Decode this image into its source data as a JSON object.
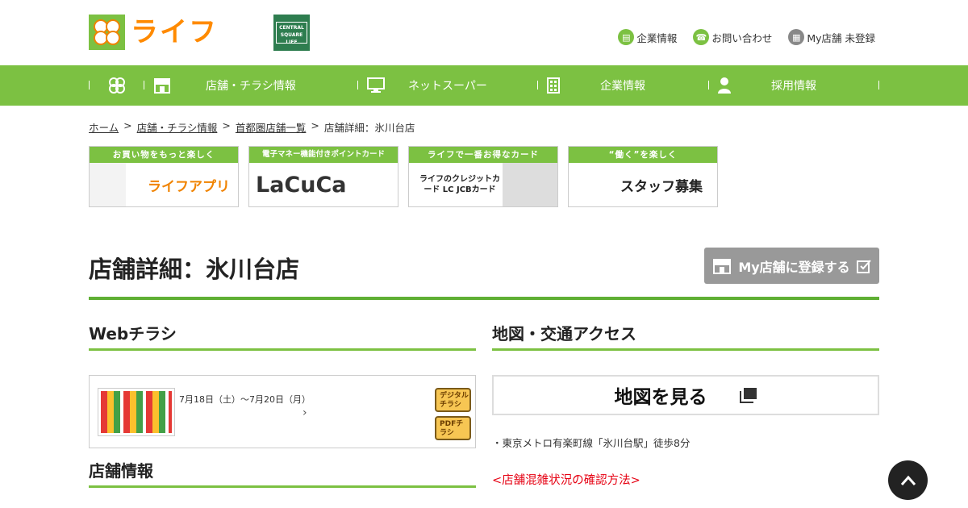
{
  "header": {
    "logo_text": "ライフ",
    "central_square_logo": "CENTRAL SQUARE LIFE",
    "links": {
      "company": "企業情報",
      "contact": "お問い合わせ",
      "mystore": "My店舗 未登録"
    }
  },
  "nav": {
    "items": [
      {
        "label": "店舗・チラシ情報",
        "icon": "store-icon"
      },
      {
        "label": "ネットスーパー",
        "icon": "monitor-icon"
      },
      {
        "label": "企業情報",
        "icon": "building-icon"
      },
      {
        "label": "採用情報",
        "icon": "person-icon"
      }
    ]
  },
  "breadcrumb": {
    "home": "ホーム",
    "stores": "店舗・チラシ情報",
    "metro_list": "首都圏店舗一覧",
    "current": "店舗詳細：氷川台店"
  },
  "banners": [
    {
      "top": "お買い物をもっと楽しく",
      "body": "ライフアプリ"
    },
    {
      "top": "電子マネー機能付きポイントカード",
      "body": "LaCuCa"
    },
    {
      "top": "ライフで一番お得なカード",
      "body": "ライフのクレジットカード LC JCBカード"
    },
    {
      "top": "“働く”を楽しく",
      "body": "スタッフ募集"
    }
  ],
  "page": {
    "title": "店舗詳細：氷川台店",
    "mystore_button": "My店舗に登録する"
  },
  "sections": {
    "web_flyer": "Webチラシ",
    "map_access": "地図・交通アクセス",
    "store_info": "店舗情報"
  },
  "flyer": {
    "date_range": "7月18日（土）～7月20日（月）",
    "digital_button": "デジタルチラシ",
    "pdf_button": "PDFチラシ"
  },
  "map": {
    "button_label": "地図を見る",
    "access_text": "・東京メトロ有楽町線「氷川台駅」徒歩8分",
    "congestion_link": "<店舗混雑状況の確認方法>"
  },
  "colors": {
    "brand_green": "#7cc142",
    "brand_orange": "#ff8a00",
    "link_red": "#e60012"
  }
}
